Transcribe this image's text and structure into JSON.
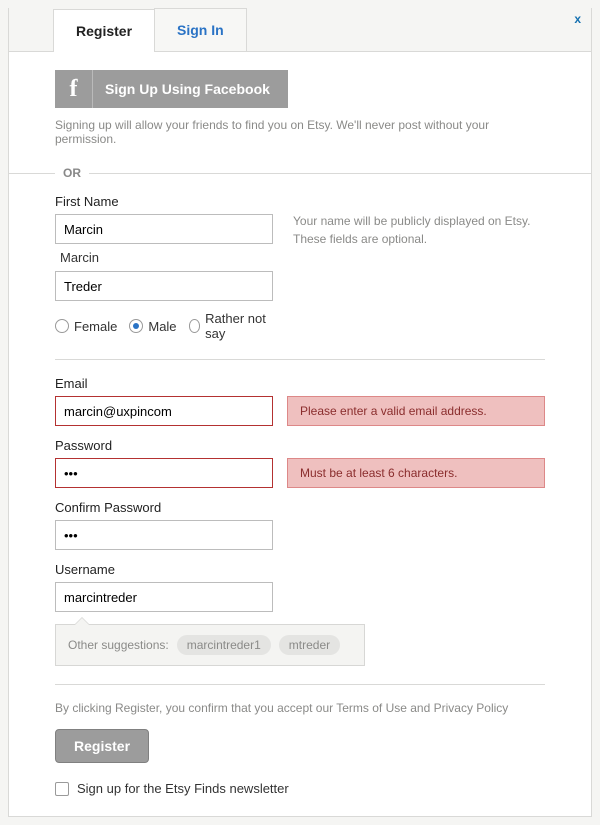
{
  "close": "x",
  "tabs": {
    "register": "Register",
    "signin": "Sign In"
  },
  "facebook": {
    "icon": "f",
    "label": "Sign Up Using Facebook",
    "help": "Signing up will allow your friends to find you on Etsy. We'll never post without your permission."
  },
  "or": "OR",
  "name": {
    "first_label": "First Name",
    "first_value": "Marcin",
    "last_label": "Marcin",
    "last_value": "Treder",
    "help": "Your name will be publicly displayed on Etsy. These fields are optional."
  },
  "gender": {
    "female": "Female",
    "male": "Male",
    "rather": "Rather not say",
    "selected": "male"
  },
  "email": {
    "label": "Email",
    "value": "marcin@uxpincom",
    "error": "Please enter a valid email address."
  },
  "password": {
    "label": "Password",
    "value": "•••",
    "error": "Must be at least 6 characters."
  },
  "confirm": {
    "label": "Confirm Password",
    "value": "•••"
  },
  "username": {
    "label": "Username",
    "value": "marcintreder",
    "suggestion_label": "Other suggestions:",
    "suggestions": [
      "marcintreder1",
      "mtreder"
    ]
  },
  "legal": "By clicking Register, you confirm that you accept our Terms of Use and Privacy Policy",
  "register_button": "Register",
  "newsletter": "Sign up for the Etsy Finds newsletter"
}
